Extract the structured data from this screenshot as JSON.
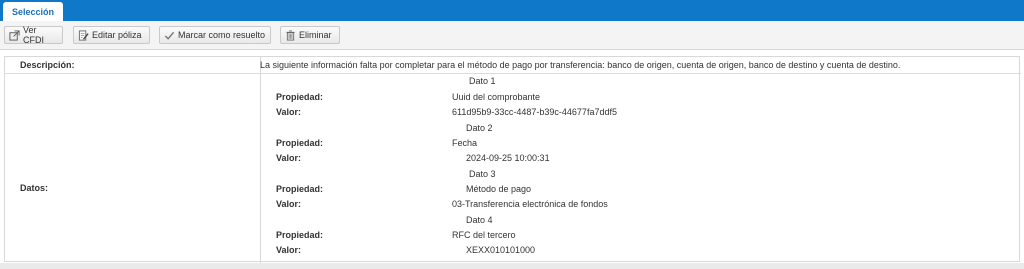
{
  "tabs": [
    {
      "label": "Selección"
    }
  ],
  "toolbar": {
    "view_cfdi": "Ver CFDI",
    "edit_poliza": "Editar póliza",
    "mark_resolved": "Marcar como resuelto",
    "delete": "Eliminar"
  },
  "details": {
    "description_label": "Descripción:",
    "description_value": "La siguiente información falta por completar para el método de pago por transferencia: banco de origen, cuenta de origen, banco de destino y cuenta de destino.",
    "data_label": "Datos:",
    "items": [
      {
        "title": "Dato 1",
        "prop_label": "Propiedad:",
        "prop_value": "Uuid del comprobante",
        "val_label": "Valor:",
        "value": "611d95b9-33cc-4487-b39c-44677fa7ddf5"
      },
      {
        "title": "Dato 2",
        "prop_label": "Propiedad:",
        "prop_value": "Fecha",
        "val_label": "Valor:",
        "value": "2024-09-25 10:00:31"
      },
      {
        "title": "Dato 3",
        "prop_label": "Propiedad:",
        "prop_value": "Método de pago",
        "val_label": "Valor:",
        "value": "03-Transferencia electrónica de fondos"
      },
      {
        "title": "Dato 4",
        "prop_label": "Propiedad:",
        "prop_value": "RFC del tercero",
        "val_label": "Valor:",
        "value": "XEXX010101000"
      }
    ]
  }
}
